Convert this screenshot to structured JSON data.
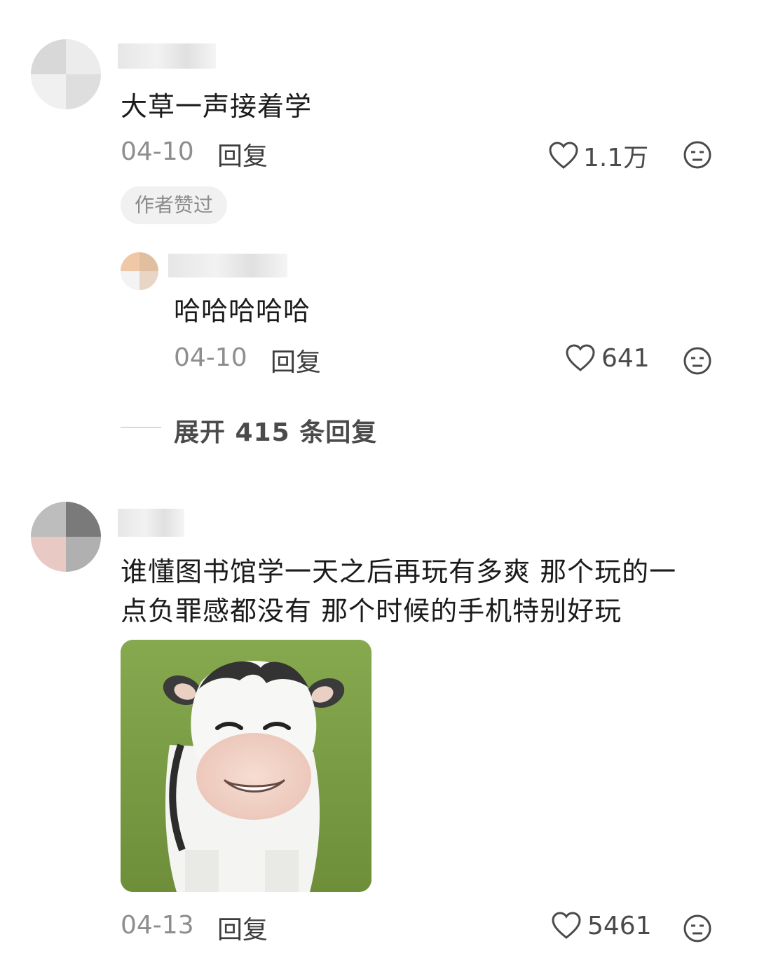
{
  "comments": [
    {
      "text": "大草一声接着学",
      "date": "04-10",
      "reply_label": "回复",
      "likes": "1.1万",
      "badge": "作者赞过",
      "replies": [
        {
          "text": "哈哈哈哈哈",
          "date": "04-10",
          "reply_label": "回复",
          "likes": "641"
        }
      ],
      "expand_label": "展开 415 条回复"
    },
    {
      "text_line1": "谁懂图书馆学一天之后再玩有多爽 那个玩的一",
      "text_line2": "点负罪感都没有 那个时候的手机特别好玩",
      "date": "04-13",
      "reply_label": "回复",
      "likes": "5461"
    }
  ],
  "icons": {
    "like": "heart-outline-icon",
    "reaction": "neutral-face-icon"
  },
  "colors": {
    "text": "#1b1b1b",
    "meta": "#8e8e8e",
    "badge_bg": "#f1f1f1",
    "sticker_bg": "#7a9a45"
  }
}
